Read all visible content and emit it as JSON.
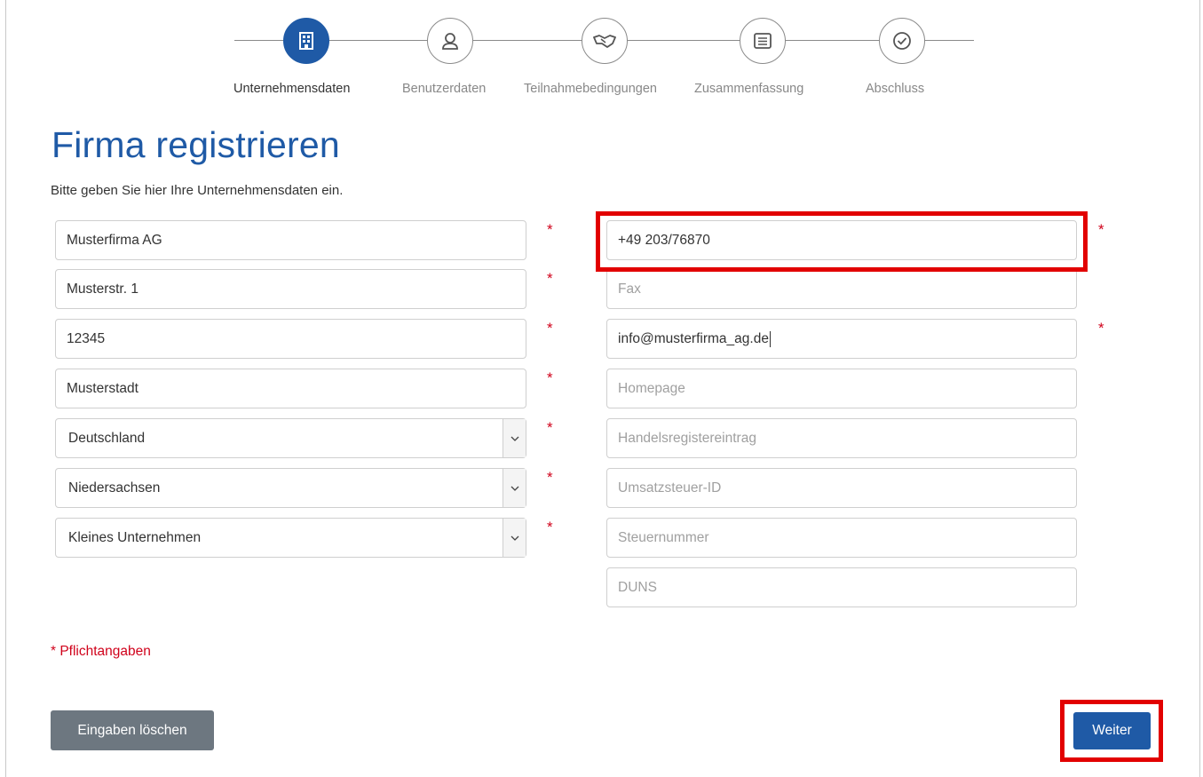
{
  "steps": [
    {
      "label": "Unternehmensdaten",
      "icon": "building-icon",
      "active": true
    },
    {
      "label": "Benutzerdaten",
      "icon": "user-icon",
      "active": false
    },
    {
      "label": "Teilnahmebedingungen",
      "icon": "handshake-icon",
      "active": false
    },
    {
      "label": "Zusammenfassung",
      "icon": "list-icon",
      "active": false
    },
    {
      "label": "Abschluss",
      "icon": "check-circle-icon",
      "active": false
    }
  ],
  "page": {
    "title": "Firma registrieren",
    "subtitle": "Bitte geben Sie hier Ihre Unternehmensdaten ein."
  },
  "left_fields": {
    "company_name": "Musterfirma AG",
    "street": "Musterstr. 1",
    "zip": "12345",
    "city": "Musterstadt",
    "country": "Deutschland",
    "state": "Niedersachsen",
    "company_size": "Kleines Unternehmen"
  },
  "right_fields": {
    "phone": "+49 203/76870",
    "fax_placeholder": "Fax",
    "email": "info@musterfirma_ag.de",
    "homepage_placeholder": "Homepage",
    "trade_register_placeholder": "Handelsregistereintrag",
    "vat_id_placeholder": "Umsatzsteuer-ID",
    "tax_number_placeholder": "Steuernummer",
    "duns_placeholder": "DUNS"
  },
  "required_marker": "*",
  "required_note": "* Pflichtangaben",
  "buttons": {
    "clear": "Eingaben löschen",
    "next": "Weiter"
  },
  "colors": {
    "primary": "#1f5aa6",
    "required": "#d0021b",
    "highlight": "#e20000",
    "secondary_button": "#6d7780"
  }
}
